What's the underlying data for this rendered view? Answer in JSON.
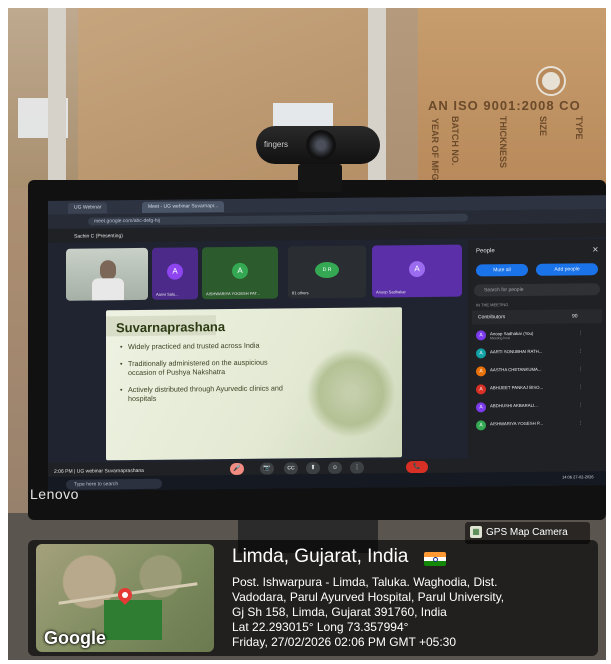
{
  "photo": {
    "box_print": "AN ISO 9001:2008 CO",
    "box_side_1": "YEAR OF MFG",
    "box_side_2": "BATCH NO.",
    "box_side_3": "THICKNESS",
    "box_side_4": "SIZE",
    "box_side_5": "TYPE",
    "webcam_brand": "fingers",
    "monitor_brand": "Lenovo"
  },
  "browser": {
    "tabs": [
      {
        "label": "UG Webinar"
      },
      {
        "label": "Meet - UG webinar Suvarnapr..."
      }
    ],
    "url": "meet.google.com/abc-defg-hij"
  },
  "meet": {
    "presenting_label": "Sachin C (Presenting)",
    "tiles": [
      {
        "name": "",
        "initial": ""
      },
      {
        "name": "Aanvi Salu...",
        "initial": "A"
      },
      {
        "name": "AISHWARIYA YOGESH PAT...",
        "initial": "A"
      },
      {
        "name": "81 others",
        "initial": "D R"
      },
      {
        "name": "Anoop Sadhakar",
        "initial": "A"
      }
    ],
    "time": "2:06 PM",
    "meeting_name": "UG webinar Suvarnaprashana",
    "controls": {
      "mic": "🎤",
      "cam": "📷",
      "captions": "CC",
      "present": "⬆",
      "emoji": "☺",
      "more": "⋮",
      "end": "📞"
    }
  },
  "slide": {
    "title": "Suvarnaprashana",
    "bullets": [
      "Widely practiced and trusted across India",
      "Traditionally administered on the auspicious occasion of Pushya Nakshatra",
      "Actively distributed through Ayurvedic clinics and hospitals"
    ]
  },
  "people_panel": {
    "title": "People",
    "close": "✕",
    "mute_all": "Mute all",
    "add_people": "Add people",
    "search_placeholder": "Search for people",
    "in_meeting": "IN THE MEETING",
    "contributors_label": "Contributors",
    "contributors_count": "90",
    "people": [
      {
        "initial": "A",
        "name": "Anoop Sadhakar (You)",
        "sub": "Meeting host",
        "color": "#7c3aed"
      },
      {
        "initial": "A",
        "name": "AARTI SONUBHAI RATH...",
        "sub": "",
        "color": "#12a2a6"
      },
      {
        "initial": "A",
        "name": "AASTHA CHETANKUMA...",
        "sub": "",
        "color": "#e8710a"
      },
      {
        "initial": "A",
        "name": "ABHIJEET PANKAJ BISO...",
        "sub": "",
        "color": "#d93025"
      },
      {
        "initial": "A",
        "name": "ABDHUSHI AKBARALI...",
        "sub": "",
        "color": "#7c3aed"
      },
      {
        "initial": "A",
        "name": "AISHWARIYA YOGESH P...",
        "sub": "",
        "color": "#34a853"
      }
    ]
  },
  "taskbar": {
    "search": "Type here to search",
    "time": "14:06",
    "date": "27-02-2026"
  },
  "gps": {
    "tag": "GPS Map Camera",
    "location_title": "Limda, Gujarat, India",
    "address_line_1": "Post. Ishwarpura - Limda, Taluka. Waghodia, Dist.",
    "address_line_2": "Vadodara, Parul Ayurved Hospital, Parul University,",
    "address_line_3": "Gj Sh 158, Limda, Gujarat 391760, India",
    "coords": "Lat 22.293015° Long 73.357994°",
    "datetime": "Friday, 27/02/2026 02:06 PM GMT +05:30",
    "map_logo": "Google"
  },
  "colors": {
    "accent": "#1a73e8",
    "end_call": "#d93025",
    "flag_saffron": "#ff9933",
    "flag_white": "#ffffff",
    "flag_green": "#138808"
  }
}
